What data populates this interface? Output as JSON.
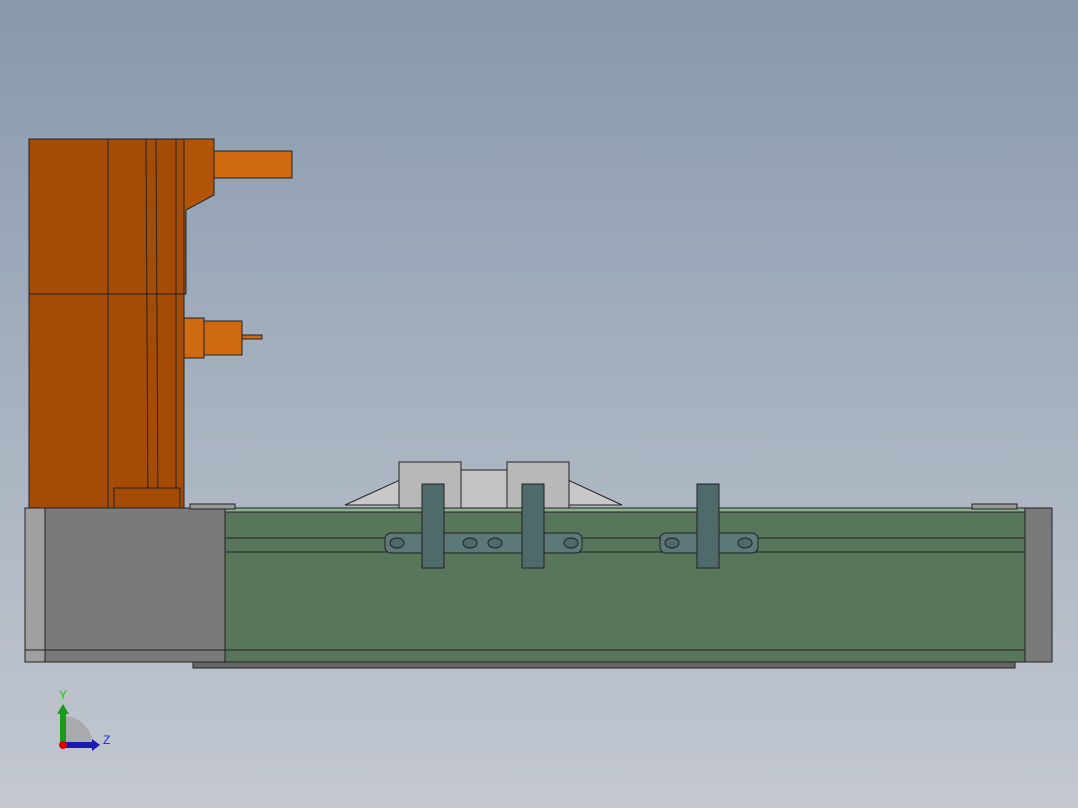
{
  "viewport": {
    "background_top": "#8898ad",
    "background_bottom": "#c3c8d0"
  },
  "model": {
    "motor_color": "#a44c06",
    "rail_color": "#58765a",
    "endcap_color": "#7a7a7a",
    "bracket_color": "#4f6a6a"
  },
  "triad": {
    "y_label": "Y",
    "z_label": "Z"
  }
}
